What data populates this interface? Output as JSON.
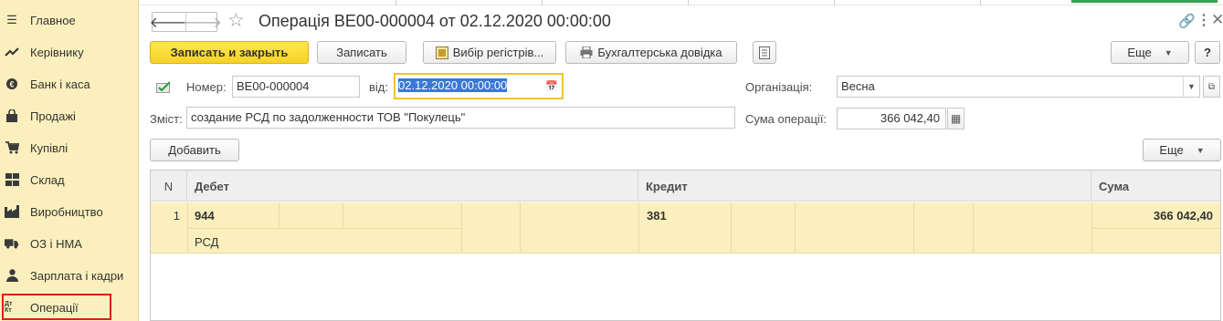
{
  "sidebar": {
    "items": [
      {
        "label": "Главное",
        "icon": "menu-icon"
      },
      {
        "label": "Керівнику",
        "icon": "trend-icon"
      },
      {
        "label": "Банк і каса",
        "icon": "coin-icon"
      },
      {
        "label": "Продажі",
        "icon": "bag-icon"
      },
      {
        "label": "Купівлі",
        "icon": "cart-icon"
      },
      {
        "label": "Склад",
        "icon": "warehouse-icon"
      },
      {
        "label": "Виробництво",
        "icon": "factory-icon"
      },
      {
        "label": "ОЗ і НМА",
        "icon": "truck-icon"
      },
      {
        "label": "Зарплата і кадри",
        "icon": "person-icon"
      },
      {
        "label": "Операції",
        "icon": "dt-kt-icon",
        "badge": "Дт Кт"
      }
    ],
    "active": "Операції"
  },
  "header": {
    "title": "Операція ВЕ00-000004 от 02.12.2020 00:00:00"
  },
  "toolbar": {
    "save_close": "Записать и закрыть",
    "save": "Записать",
    "select_registers": "Вибір регістрів...",
    "accounting_note": "Бухгалтерська довідка",
    "more": "Еще",
    "help": "?"
  },
  "form": {
    "number_label": "Номер:",
    "number_value": "ВЕ00-000004",
    "date_label": "від:",
    "date_value": "02.12.2020 00:00:00",
    "org_label": "Організація:",
    "org_value": "Весна",
    "content_label": "Зміст:",
    "content_value": "создание РСД по задолженности ТОВ \"Покулець\"",
    "sum_label": "Сума операції:",
    "sum_value": "366 042,40"
  },
  "table_toolbar": {
    "add": "Добавить",
    "more": "Еще"
  },
  "table": {
    "columns": [
      "N",
      "Дебет",
      "Кредит",
      "Сума"
    ],
    "rows": [
      {
        "n": "1",
        "debit": "944",
        "debit_sub": "РСД",
        "credit": "381",
        "sum": "366 042,40"
      }
    ]
  },
  "colors": {
    "sidebar_bg": "#fbf0bd",
    "primary_button": "#f6d22a",
    "active_outline": "#e0191f",
    "date_focus": "#f2c230",
    "selection": "#3a78d6"
  }
}
